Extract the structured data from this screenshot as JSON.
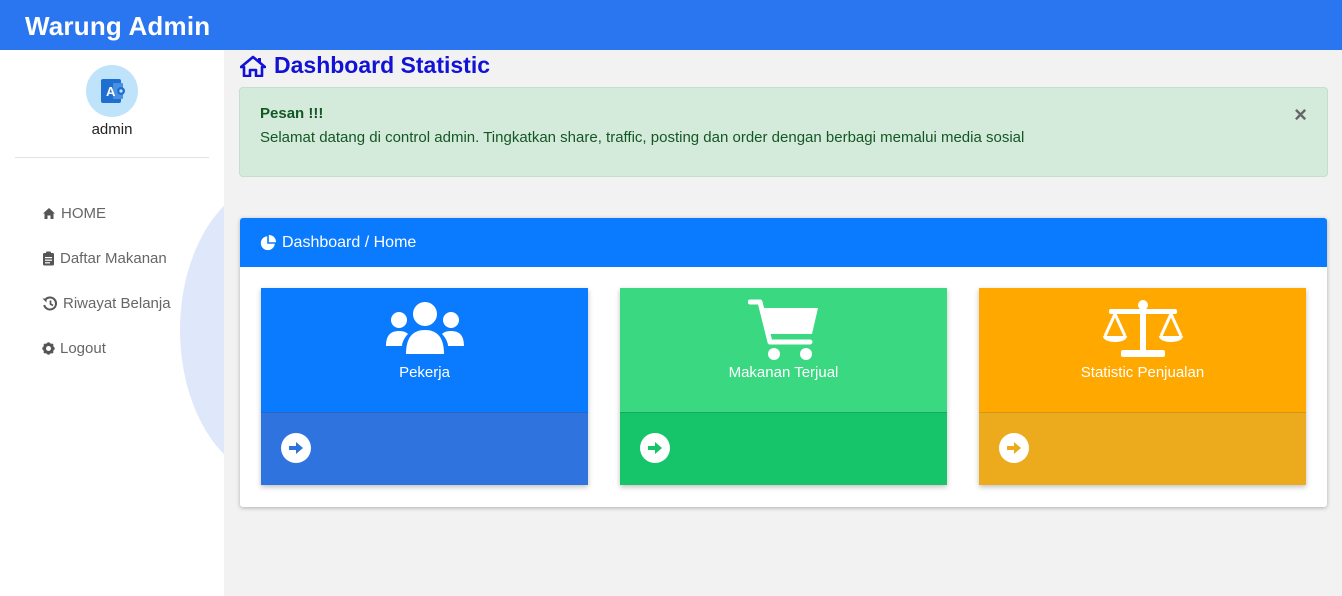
{
  "app": {
    "title": "Warung Admin"
  },
  "user": {
    "name": "admin",
    "avatar_letter": "A"
  },
  "sidebar": {
    "items": [
      {
        "label": "HOME",
        "icon": "home-icon"
      },
      {
        "label": "Daftar Makanan",
        "icon": "clipboard-icon"
      },
      {
        "label": "Riwayat Belanja",
        "icon": "history-icon"
      },
      {
        "label": "Logout",
        "icon": "gear-icon"
      }
    ]
  },
  "page": {
    "title": "Dashboard Statistic",
    "icon": "home-icon"
  },
  "alert": {
    "title": "Pesan !!!",
    "message": "Selamat datang di control admin. Tingkatkan share, traffic, posting dan order dengan berbagi memalui media sosial",
    "close": "×"
  },
  "panel": {
    "title": "Dashboard / Home",
    "icon": "pie-chart-icon"
  },
  "cards": [
    {
      "label": "Pekerja",
      "icon": "users-icon",
      "color": "#0a7bff",
      "footer_color": "#2f74de"
    },
    {
      "label": "Makanan Terjual",
      "icon": "cart-icon",
      "color": "#3bd882",
      "footer_color": "#16c46a"
    },
    {
      "label": "Statistic Penjualan",
      "icon": "balance-scale-icon",
      "color": "#ffa800",
      "footer_color": "#ecab1d"
    }
  ],
  "colors": {
    "topbar": "#2a76f0",
    "title": "#1212d6",
    "panel_head": "#0a7bff",
    "alert_bg": "#d4ebdb"
  }
}
